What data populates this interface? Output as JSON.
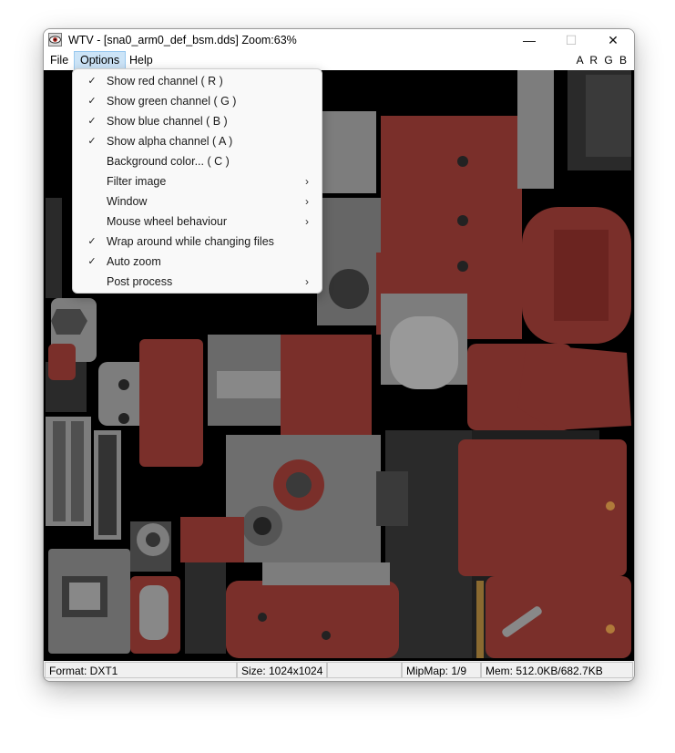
{
  "window": {
    "title": "WTV - [sna0_arm0_def_bsm.dds] Zoom:63%",
    "minimize_glyph": "—",
    "maximize_glyph": "☐",
    "close_glyph": "✕"
  },
  "menubar": {
    "file": "File",
    "options": "Options",
    "help": "Help",
    "channels": "A R G B"
  },
  "options_menu": [
    {
      "label": "Show red channel ( R )",
      "checked": true,
      "submenu": false
    },
    {
      "label": "Show green channel ( G )",
      "checked": true,
      "submenu": false
    },
    {
      "label": "Show blue channel ( B )",
      "checked": true,
      "submenu": false
    },
    {
      "label": "Show alpha channel ( A )",
      "checked": true,
      "submenu": false
    },
    {
      "label": "Background color... ( C )",
      "checked": false,
      "submenu": false
    },
    {
      "label": "Filter image",
      "checked": false,
      "submenu": true
    },
    {
      "label": "Window",
      "checked": false,
      "submenu": true
    },
    {
      "label": "Mouse wheel behaviour",
      "checked": false,
      "submenu": true
    },
    {
      "label": "Wrap around while changing files",
      "checked": true,
      "submenu": false
    },
    {
      "label": "Auto zoom",
      "checked": true,
      "submenu": false
    },
    {
      "label": "Post process",
      "checked": false,
      "submenu": true
    }
  ],
  "glyphs": {
    "check": "✓",
    "submenu_arrow": "›"
  },
  "status": {
    "format": "Format: DXT1",
    "size": "Size: 1024x1024",
    "empty": "",
    "mipmap": "MipMap: 1/9",
    "mem": "Mem: 512.0KB/682.7KB"
  },
  "colors": {
    "texture_red": "#7a2f2a",
    "texture_gray": "#7d7d7d",
    "texture_dark": "#2a2a2a",
    "menu_highlight": "#cce4f7"
  }
}
